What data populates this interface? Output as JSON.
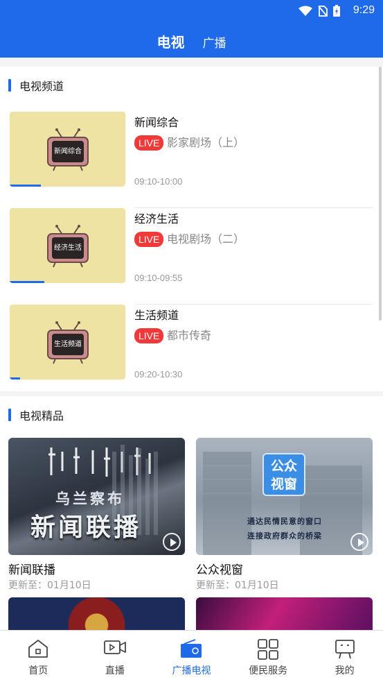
{
  "status_bar": {
    "time": "9:29"
  },
  "header": {
    "tabs": [
      {
        "label": "电视",
        "active": true
      },
      {
        "label": "广播",
        "active": false
      }
    ]
  },
  "tv_channels": {
    "title": "电视频道",
    "items": [
      {
        "name": "新闻综合",
        "thumb_label": "新闻综合",
        "live": "LIVE",
        "program": "影家剧场（上）",
        "time": "09:10-10:00",
        "progress": 0.27
      },
      {
        "name": "经济生活",
        "thumb_label": "经济生活",
        "live": "LIVE",
        "program": "电视剧场（二）",
        "time": "09:10-09:55",
        "progress": 0.3
      },
      {
        "name": "生活频道",
        "thumb_label": "生活频道",
        "live": "LIVE",
        "program": "都市传奇",
        "time": "09:20-10:30",
        "progress": 0.09
      }
    ]
  },
  "tv_featured": {
    "title": "电视精品",
    "items": [
      {
        "title": "新闻联播",
        "updated": "更新至：01月10日",
        "cover_text_top": "乌兰察布",
        "cover_text_main": "新闻联播"
      },
      {
        "title": "公众视窗",
        "updated": "更新至：01月10日",
        "cover_logo_line1": "公众",
        "cover_logo_line2": "视窗",
        "cover_slogan_1": "通达民情民意的窗口",
        "cover_slogan_2": "连接政府群众的桥梁"
      }
    ]
  },
  "bottom_nav": {
    "items": [
      {
        "label": "首页",
        "icon": "home-icon",
        "active": false
      },
      {
        "label": "直播",
        "icon": "video-camera-icon",
        "active": false
      },
      {
        "label": "广播电视",
        "icon": "radio-tv-icon",
        "active": true
      },
      {
        "label": "便民服务",
        "icon": "grid-services-icon",
        "active": false
      },
      {
        "label": "我的",
        "icon": "profile-icon",
        "active": false
      }
    ]
  },
  "colors": {
    "primary": "#1f6ae8",
    "live_badge": "#f03a3a",
    "thumb_bg": "#efe3a4"
  }
}
